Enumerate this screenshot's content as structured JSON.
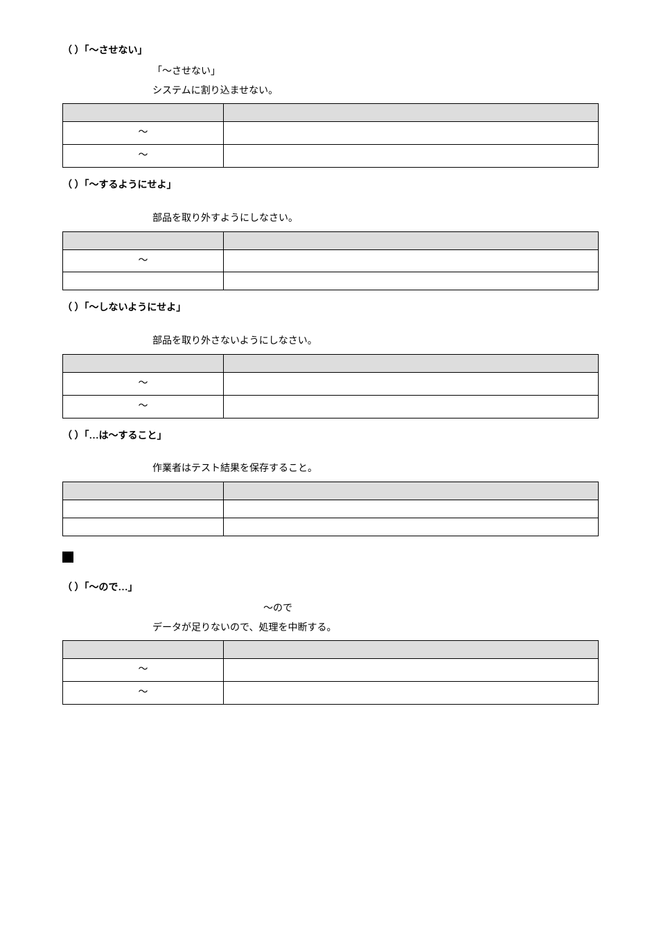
{
  "sections": {
    "s1": {
      "title": "（ ）「～させない」",
      "lines": [
        "「～させない」",
        "システムに割り込ませない。"
      ],
      "rows": [
        "～",
        "～"
      ]
    },
    "s2": {
      "title": "（ ）「～するようにせよ」",
      "lines": [
        "部品を取り外すようにしなさい。"
      ],
      "rows": [
        "～",
        ""
      ]
    },
    "s3": {
      "title": "（ ）「～しないようにせよ」",
      "lines": [
        "部品を取り外さないようにしなさい。"
      ],
      "rows": [
        "～",
        "～"
      ]
    },
    "s4": {
      "title": "（ ）「…は～すること」",
      "lines": [
        "作業者はテスト結果を保存すること。"
      ],
      "rows": [
        "",
        ""
      ]
    },
    "s5": {
      "title": "（ ）「～ので…」",
      "lead": "～ので",
      "lines": [
        "データが足りないので、処理を中断する。"
      ],
      "rows": [
        "～",
        "～"
      ]
    }
  }
}
